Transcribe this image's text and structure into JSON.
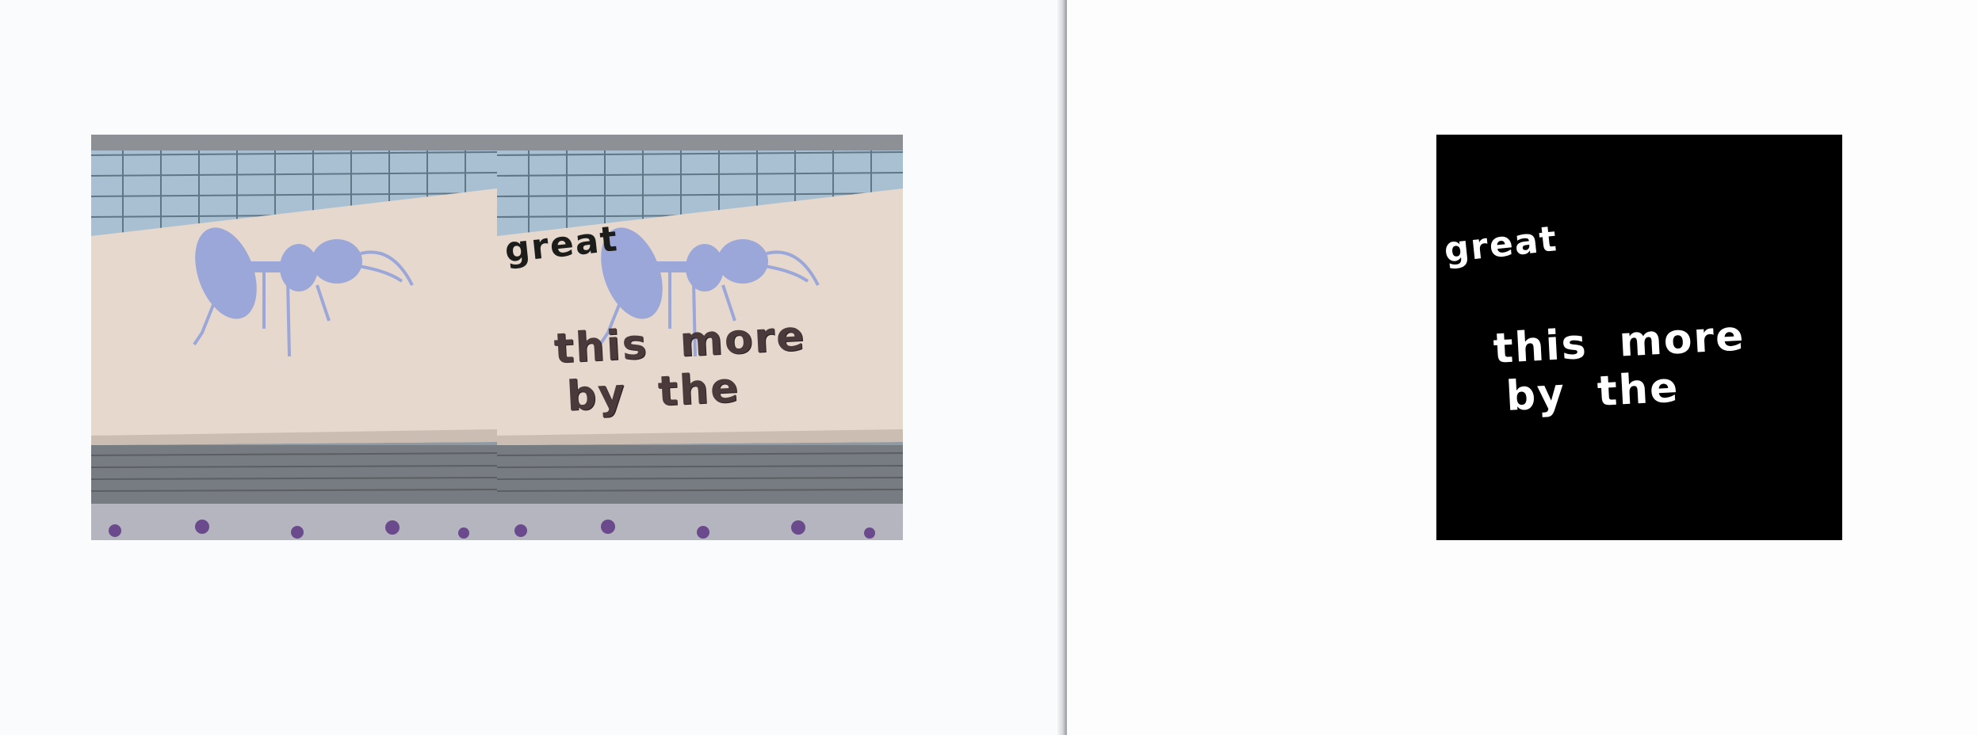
{
  "images": {
    "original": {
      "name": "storefront-sign-original",
      "shows": "storefront awning with ant logo"
    },
    "rendered": {
      "name": "storefront-sign-with-text"
    },
    "mask": {
      "name": "text-mask"
    }
  },
  "sign_text": {
    "word_1": "great",
    "line_1": "this  more",
    "line_2": "by  the"
  },
  "colors": {
    "page_background": "#fafbfd",
    "awning": "#e6d8cc",
    "ant_logo": "#9aa7d8",
    "rendered_text": "#4a3a3c",
    "mask_background": "#000000",
    "mask_text": "#ffffff"
  },
  "icons": {
    "collapse_handle": "chevron-right-icon"
  }
}
